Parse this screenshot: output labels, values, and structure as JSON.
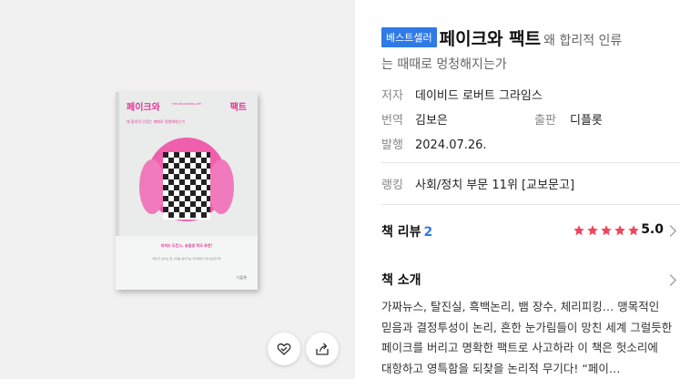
{
  "cover": {
    "title_left": "페이크와",
    "title_right": "팩트",
    "small_caption": "THE REASONING LIFE",
    "subtitle": "왜 합리적 인류는 때때로 멍청해지는가",
    "recommendation": "리처드 도킨스, 송길영 적극 추천!",
    "quote": "\"페이크 넘치는 현 시대를 살아가는 우리에게 가장 필요한 책\"",
    "publisher": "디플롯",
    "colors": {
      "accent": "#e8359a"
    }
  },
  "actions": {
    "wish_icon": "heart-check-icon",
    "share_icon": "share-icon"
  },
  "book": {
    "badge": "베스트셀러",
    "title": "페이크와 팩트",
    "subtitle_part1": "왜 합리적 인류",
    "subtitle_part2": "는 때때로 멍청해지는가"
  },
  "meta": {
    "author_label": "저자",
    "author": "데이비드 로버트 그라임스",
    "translator_label": "번역",
    "translator": "김보은",
    "publisher_label": "출판",
    "publisher": "디플롯",
    "date_label": "발행",
    "date": "2024.07.26.",
    "rank_label": "랭킹",
    "rank": "사회/정치 부문 11위 [교보문고]"
  },
  "review": {
    "label": "책 리뷰",
    "count": "2",
    "score": "5.0",
    "stars": 5,
    "star_color": "#f0455a"
  },
  "intro": {
    "label": "책 소개",
    "text": "가짜뉴스, 탈진실, 흑백논리, 뱀 장수, 체리피킹… 맹목적인 믿음과 결정투성이 논리, 흔한 눈가림들이 망친 세계 그럴듯한 페이크를 버리고 명확한 팩트로 사고하라 이 책은 헛소리에 대항하고 영특함을 되찾을 논리적 무기다! “페이…"
  }
}
